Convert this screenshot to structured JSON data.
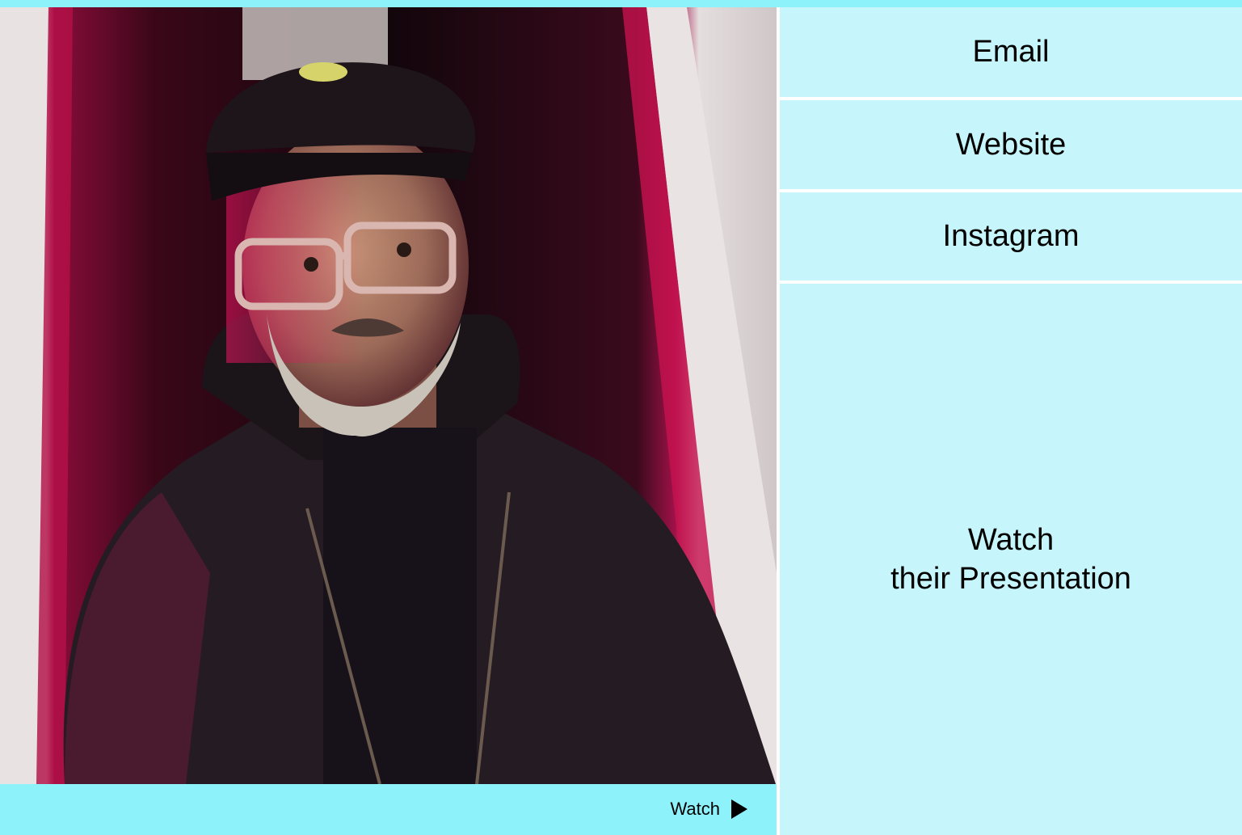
{
  "links": {
    "email": "Email",
    "website": "Website",
    "instagram": "Instagram"
  },
  "presentation": {
    "line1": "Watch",
    "line2": "their Presentation"
  },
  "watch_bar": {
    "label": "Watch",
    "icon": "play-icon"
  },
  "colors": {
    "bar_accent": "#8ef2fb",
    "panel_bg": "#c6f6fb",
    "neon_pink": "#e0155f"
  }
}
